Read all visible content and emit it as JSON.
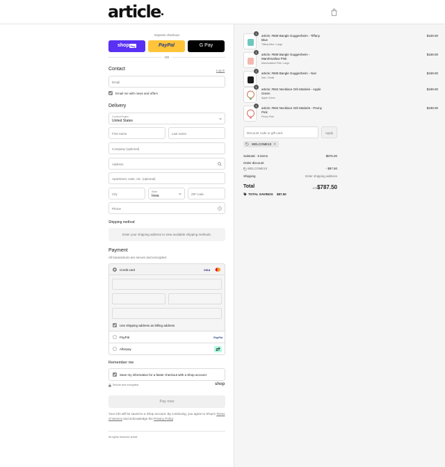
{
  "header": {
    "logo_text": "article",
    "cart_icon": "shopping-bag-icon"
  },
  "express": {
    "label": "Express checkout",
    "shop_pay": {
      "text": "shop",
      "badge": "Pay",
      "color": "#5a31f4"
    },
    "paypal": {
      "text": "PayPal",
      "color": "#ffc439"
    },
    "gpay": {
      "text": "G Pay",
      "color": "#000000"
    },
    "or": "OR"
  },
  "contact": {
    "title": "Contact",
    "login": "Log in",
    "email_placeholder": "Email",
    "news_label": "Email me with news and offers"
  },
  "delivery": {
    "title": "Delivery",
    "country_label": "Country/Region",
    "country_value": "United States",
    "first_name": "First name",
    "last_name": "Last name",
    "company": "Company (optional)",
    "address": "Address",
    "apartment": "Apartment, suite, etc. (optional)",
    "city": "City",
    "state_label": "State",
    "state_value": "Iowa",
    "zip": "ZIP code",
    "phone": "Phone"
  },
  "shipping": {
    "title": "Shipping method",
    "message": "Enter your shipping address to view available shipping methods."
  },
  "payment": {
    "title": "Payment",
    "subtitle": "All transactions are secure and encrypted.",
    "credit_card": "Credit card",
    "visa": "VISA",
    "billing_label": "Use shipping address as billing address",
    "paypal": "PayPal",
    "paypal_logo": "PayPal",
    "afterpay": "Afterpay"
  },
  "remember": {
    "title": "Remember me",
    "save_label": "Save my information for a faster checkout with a Shop account",
    "secure": "Secure and encrypted",
    "shop_logo": "shop"
  },
  "pay_button": "Pay now",
  "legal": {
    "text_before": "Your info will be saved to a Shop account. By continuing, you agree to Shop's",
    "terms": "Terms of Service",
    "middle": "and acknowledge the",
    "privacy": "Privacy Policy",
    "end": "."
  },
  "footer": "All rights reserved article",
  "cart": {
    "items": [
      {
        "name": "article; #608 Bangle Guggenheim - Tiffany Blue",
        "variant": "Tiffany Blue / Large",
        "price": "$159.00",
        "qty": "1",
        "color": "#6fc7be"
      },
      {
        "name": "article; #608 Bangle Guggenheim - Marshmallow Pink",
        "variant": "Marshmallow Pink / Large",
        "price": "$159.00",
        "qty": "1",
        "color": "#f2b8b1"
      },
      {
        "name": "article; #608 Bangle Guggenheim - Noir",
        "variant": "Noir / Small",
        "price": "$159.00",
        "qty": "1",
        "color": "#1a1a1a"
      },
      {
        "name": "article; #504 Necklace Orb Matinée - Apple Green",
        "variant": "Apple Green",
        "price": "$199.00",
        "qty": "1",
        "color": "#c8744f"
      },
      {
        "name": "article; #504 Necklace Orb Matinée - Peony Pink",
        "variant": "Peony Pink",
        "price": "$199.00",
        "qty": "1",
        "color": "#d56c5f"
      }
    ],
    "discount_placeholder": "Discount code or gift card",
    "apply": "Apply",
    "applied_code": "WELCOME10",
    "subtotal_label": "Subtotal · 5 items",
    "subtotal_value": "$875.00",
    "order_discount_label": "Order discount",
    "discount_code": "WELCOME10",
    "discount_value": "- $87.50",
    "shipping_label": "Shipping",
    "shipping_value": "Enter shipping address",
    "total_label": "Total",
    "currency": "USD",
    "total_value": "$787.50",
    "savings_label": "TOTAL SAVINGS",
    "savings_value": "$87.50"
  }
}
